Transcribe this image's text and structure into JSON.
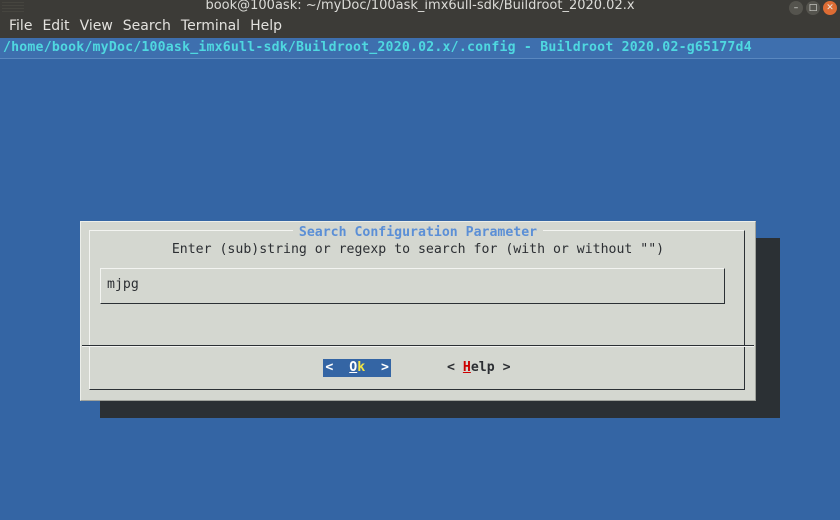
{
  "window": {
    "title": "book@100ask: ~/myDoc/100ask_imx6ull-sdk/Buildroot_2020.02.x",
    "controls": [
      {
        "name": "minimize",
        "glyph": "–"
      },
      {
        "name": "maximize",
        "glyph": "□"
      },
      {
        "name": "close",
        "glyph": "✕"
      }
    ]
  },
  "menubar": {
    "items": [
      {
        "label": "File"
      },
      {
        "label": "Edit"
      },
      {
        "label": "View"
      },
      {
        "label": "Search"
      },
      {
        "label": "Terminal"
      },
      {
        "label": "Help"
      }
    ]
  },
  "menuconfig": {
    "header": "/home/book/myDoc/100ask_imx6ull-sdk/Buildroot_2020.02.x/.config - Buildroot 2020.02-g65177d4",
    "background_color": "#3465a4",
    "header_text_color": "#4fd8e0"
  },
  "dialog": {
    "title": "Search Configuration Parameter",
    "title_color": "#5b8fd6",
    "prompt": "Enter (sub)string or regexp to search for (with or without \"\")",
    "input": {
      "value": "mjpg",
      "placeholder": ""
    },
    "buttons": [
      {
        "name": "ok",
        "open_bracket": "<",
        "accel": "O",
        "rest": "k",
        "close_bracket": ">",
        "selected": true,
        "highlight_color": "#3465a4",
        "label_color": "#f5e642"
      },
      {
        "name": "help",
        "open_bracket": "<",
        "accel": "H",
        "rest": "elp",
        "close_bracket": ">",
        "selected": false,
        "highlight_color": "transparent",
        "label_color": "#2c2f33"
      }
    ]
  }
}
